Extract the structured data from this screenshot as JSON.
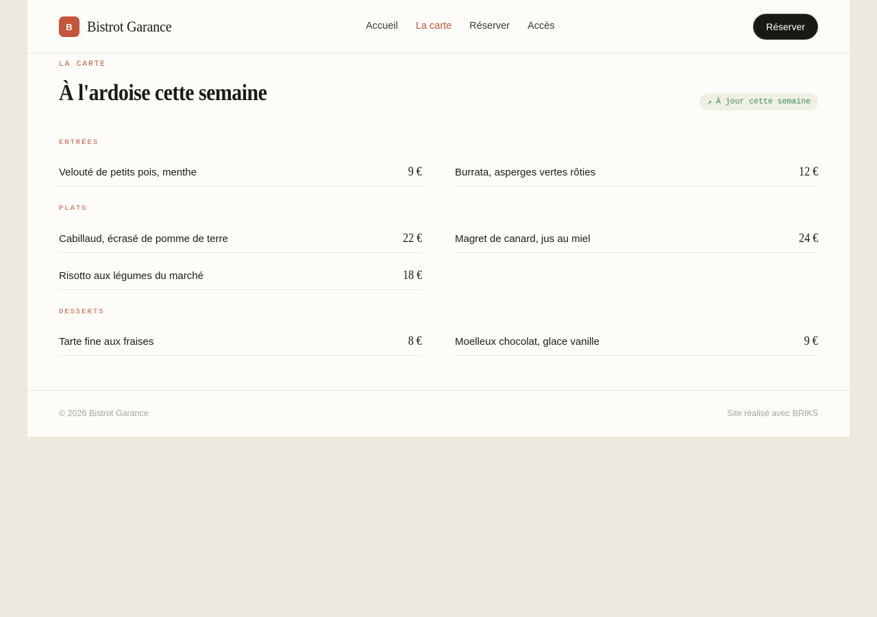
{
  "brand": {
    "logo_letter": "B",
    "name": "Bistrot Garance"
  },
  "nav": {
    "items": [
      "Accueil",
      "La carte",
      "Réserver",
      "Accès"
    ],
    "active": "La carte"
  },
  "cta_label": "Réserver",
  "hero": {
    "eyebrow": "LA CARTE",
    "title": "À l'ardoise cette semaine",
    "badge_icon": "↗",
    "badge_text": "À jour cette semaine"
  },
  "menu": {
    "entrees": {
      "label": "ENTRÉES",
      "items": [
        {
          "name": "Velouté de petits pois, menthe",
          "price": "9 €"
        },
        {
          "name": "Burrata, asperges vertes rôties",
          "price": "12 €"
        }
      ]
    },
    "plats": {
      "label": "PLATS",
      "items": [
        {
          "name": "Cabillaud, écrasé de pomme de terre",
          "price": "22 €"
        },
        {
          "name": "Magret de canard, jus au miel",
          "price": "24 €"
        },
        {
          "name": "Risotto aux légumes du marché",
          "price": "18 €"
        }
      ]
    },
    "desserts": {
      "label": "DESSERTS",
      "items": [
        {
          "name": "Tarte fine aux fraises",
          "price": "8 €"
        },
        {
          "name": "Moelleux chocolat, glace vanille",
          "price": "9 €"
        }
      ]
    }
  },
  "footer": {
    "copyright": "© 2026 Bistrot Garance",
    "credit": "Site réalisé avec BRIKS"
  },
  "colors": {
    "accent": "#c4553b",
    "background": "#ede9df",
    "card": "#fdfcf8",
    "badge_text": "#3e8a56"
  }
}
